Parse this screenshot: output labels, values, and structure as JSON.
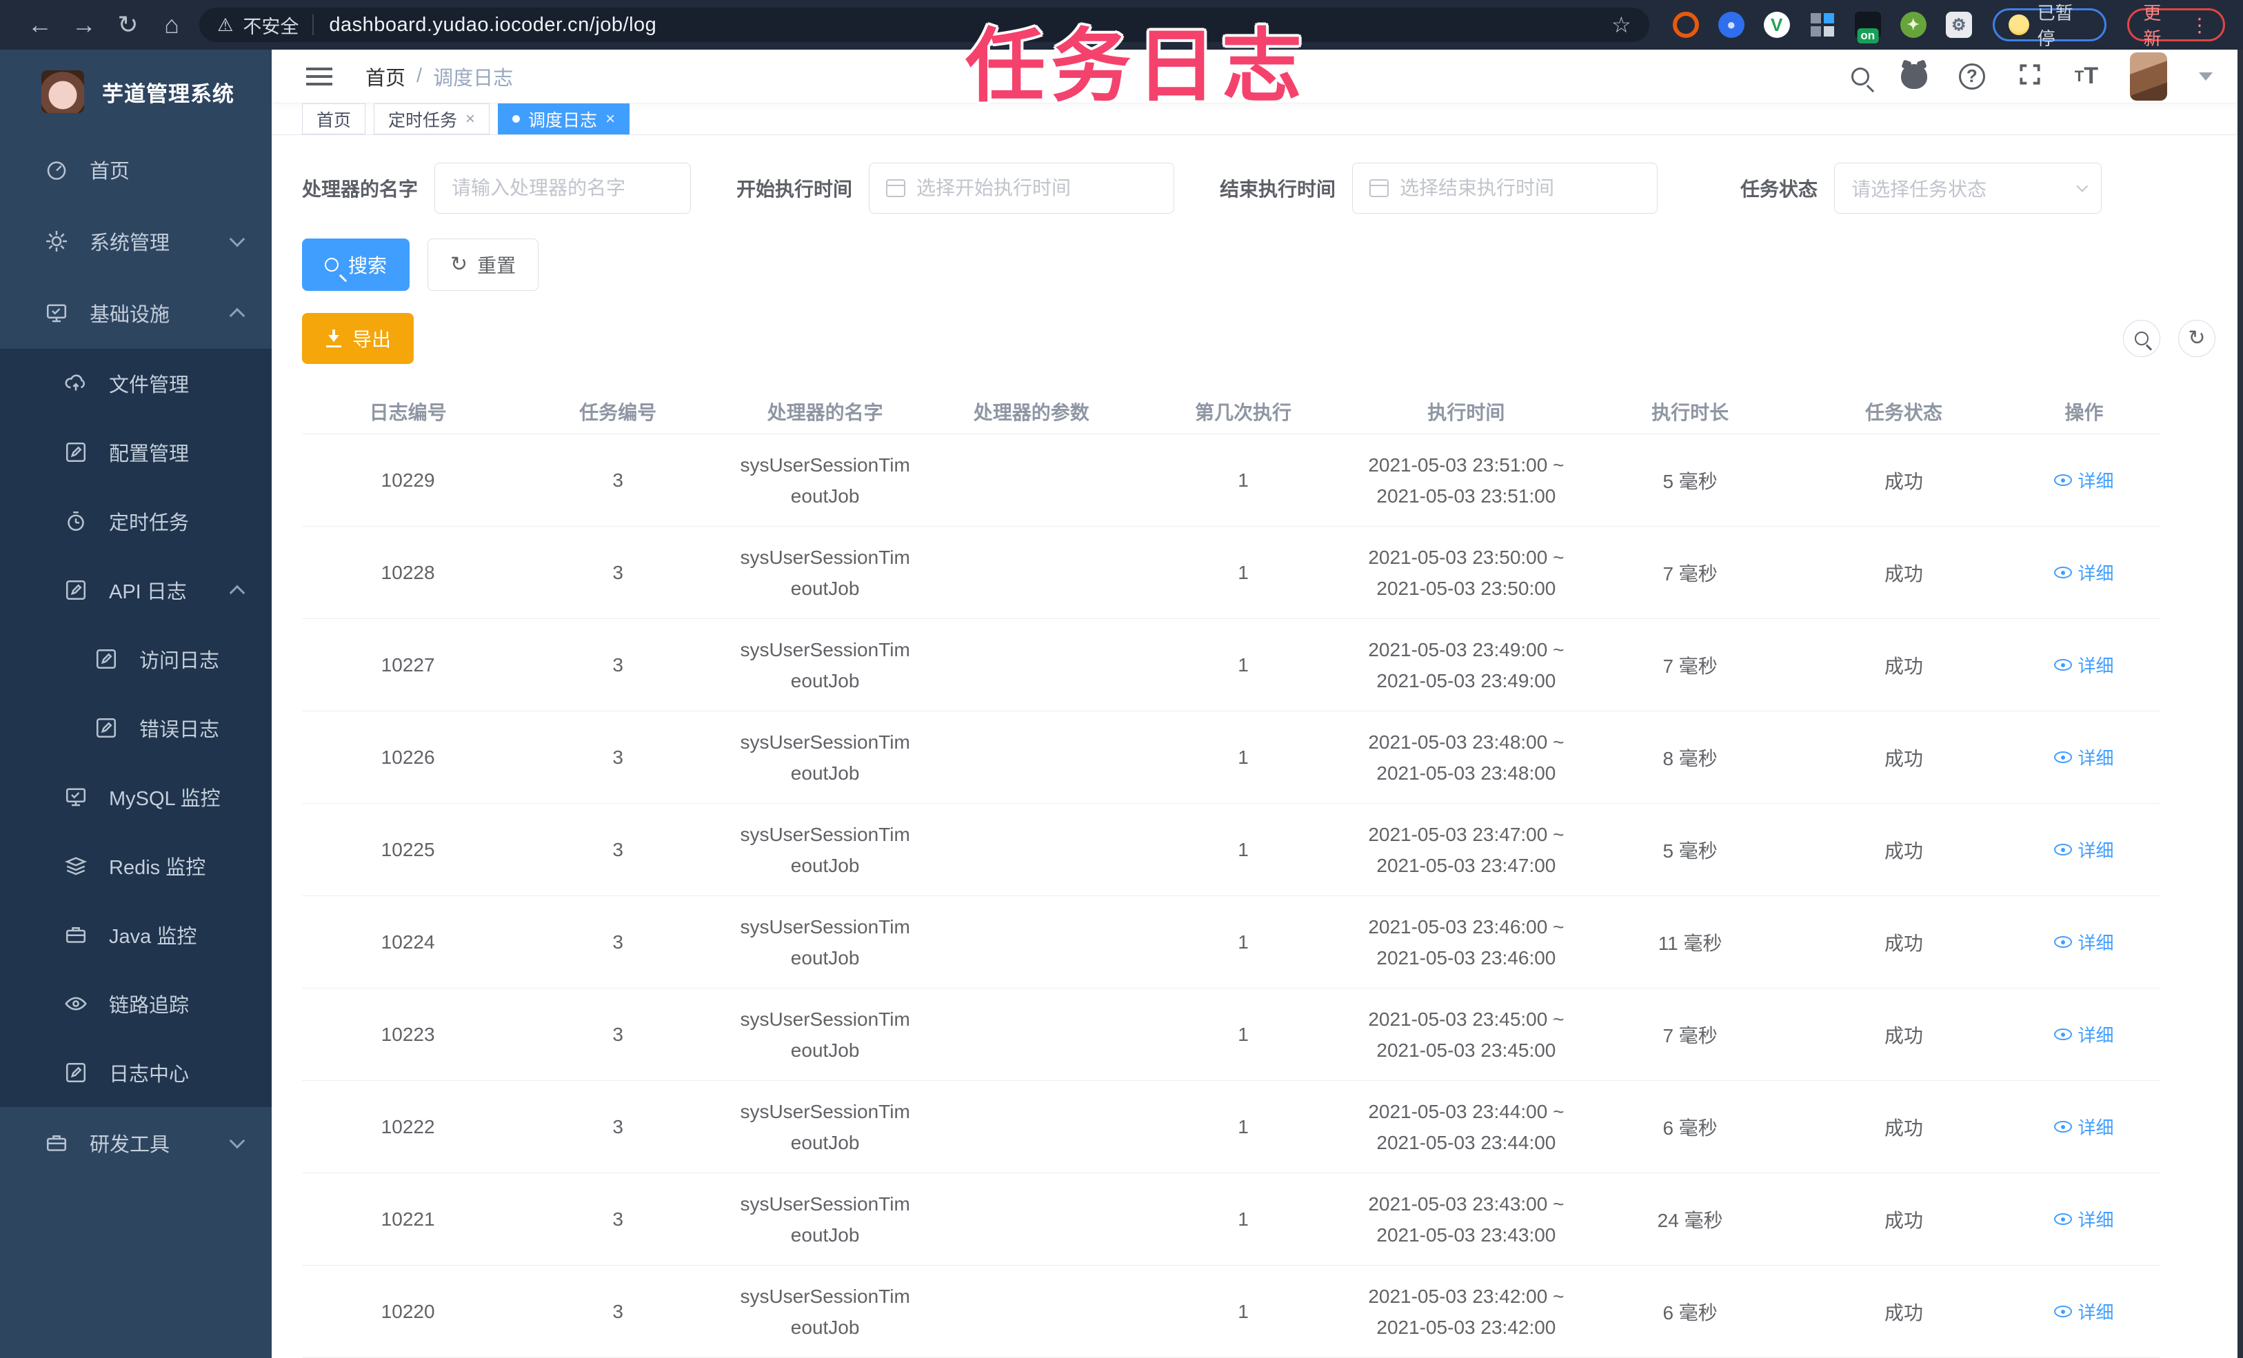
{
  "browser": {
    "security_label": "不安全",
    "url": "dashboard.yudao.iocoder.cn/job/log",
    "paused_badge": "已暂停",
    "update_badge": "更新",
    "extension_on_badge": "on"
  },
  "overlay": {
    "title": "任务日志",
    "color": "#f4426d"
  },
  "sidebar": {
    "title": "芋道管理系统",
    "home": "首页",
    "system": "系统管理",
    "infra": "基础设施",
    "file": "文件管理",
    "config": "配置管理",
    "job": "定时任务",
    "api_log": "API 日志",
    "access_log": "访问日志",
    "error_log": "错误日志",
    "mysql": "MySQL 监控",
    "redis": "Redis 监控",
    "java": "Java 监控",
    "trace": "链路追踪",
    "log_center": "日志中心",
    "dev_tools": "研发工具"
  },
  "header": {
    "breadcrumb_home": "首页",
    "breadcrumb_separator": "/",
    "breadcrumb_current": "调度日志"
  },
  "tabs": [
    {
      "label": "首页"
    },
    {
      "label": "定时任务"
    },
    {
      "label": "调度日志"
    }
  ],
  "filters": {
    "handler_label": "处理器的名字",
    "handler_placeholder": "请输入处理器的名字",
    "start_label": "开始执行时间",
    "start_placeholder": "选择开始执行时间",
    "end_label": "结束执行时间",
    "end_placeholder": "选择结束执行时间",
    "status_label": "任务状态",
    "status_placeholder": "请选择任务状态"
  },
  "toolbar": {
    "search_label": "搜索",
    "reset_label": "重置",
    "export_label": "导出",
    "primary_color": "#409eff",
    "export_color": "#f5a60b"
  },
  "table": {
    "headers": [
      "日志编号",
      "任务编号",
      "处理器的名字",
      "处理器的参数",
      "第几次执行",
      "执行时间",
      "执行时长",
      "任务状态",
      "操作"
    ],
    "detail_label": "详细",
    "rows": [
      {
        "id": "10229",
        "task": "3",
        "h1": "sysUserSessionTim",
        "h2": "eoutJob",
        "param": "",
        "n": "1",
        "t1": "2021-05-03 23:51:00 ~",
        "t2": "2021-05-03 23:51:00",
        "dur": "5 毫秒",
        "status": "成功",
        "action": "详细"
      },
      {
        "id": "10228",
        "task": "3",
        "h1": "sysUserSessionTim",
        "h2": "eoutJob",
        "param": "",
        "n": "1",
        "t1": "2021-05-03 23:50:00 ~",
        "t2": "2021-05-03 23:50:00",
        "dur": "7 毫秒",
        "status": "成功",
        "action": "详细"
      },
      {
        "id": "10227",
        "task": "3",
        "h1": "sysUserSessionTim",
        "h2": "eoutJob",
        "param": "",
        "n": "1",
        "t1": "2021-05-03 23:49:00 ~",
        "t2": "2021-05-03 23:49:00",
        "dur": "7 毫秒",
        "status": "成功",
        "action": "详细"
      },
      {
        "id": "10226",
        "task": "3",
        "h1": "sysUserSessionTim",
        "h2": "eoutJob",
        "param": "",
        "n": "1",
        "t1": "2021-05-03 23:48:00 ~",
        "t2": "2021-05-03 23:48:00",
        "dur": "8 毫秒",
        "status": "成功",
        "action": "详细"
      },
      {
        "id": "10225",
        "task": "3",
        "h1": "sysUserSessionTim",
        "h2": "eoutJob",
        "param": "",
        "n": "1",
        "t1": "2021-05-03 23:47:00 ~",
        "t2": "2021-05-03 23:47:00",
        "dur": "5 毫秒",
        "status": "成功",
        "action": "详细"
      },
      {
        "id": "10224",
        "task": "3",
        "h1": "sysUserSessionTim",
        "h2": "eoutJob",
        "param": "",
        "n": "1",
        "t1": "2021-05-03 23:46:00 ~",
        "t2": "2021-05-03 23:46:00",
        "dur": "11 毫秒",
        "status": "成功",
        "action": "详细"
      },
      {
        "id": "10223",
        "task": "3",
        "h1": "sysUserSessionTim",
        "h2": "eoutJob",
        "param": "",
        "n": "1",
        "t1": "2021-05-03 23:45:00 ~",
        "t2": "2021-05-03 23:45:00",
        "dur": "7 毫秒",
        "status": "成功",
        "action": "详细"
      },
      {
        "id": "10222",
        "task": "3",
        "h1": "sysUserSessionTim",
        "h2": "eoutJob",
        "param": "",
        "n": "1",
        "t1": "2021-05-03 23:44:00 ~",
        "t2": "2021-05-03 23:44:00",
        "dur": "6 毫秒",
        "status": "成功",
        "action": "详细"
      },
      {
        "id": "10221",
        "task": "3",
        "h1": "sysUserSessionTim",
        "h2": "eoutJob",
        "param": "",
        "n": "1",
        "t1": "2021-05-03 23:43:00 ~",
        "t2": "2021-05-03 23:43:00",
        "dur": "24 毫秒",
        "status": "成功",
        "action": "详细"
      },
      {
        "id": "10220",
        "task": "3",
        "h1": "sysUserSessionTim",
        "h2": "eoutJob",
        "param": "",
        "n": "1",
        "t1": "2021-05-03 23:42:00 ~",
        "t2": "2021-05-03 23:42:00",
        "dur": "6 毫秒",
        "status": "成功",
        "action": "详细"
      }
    ]
  }
}
